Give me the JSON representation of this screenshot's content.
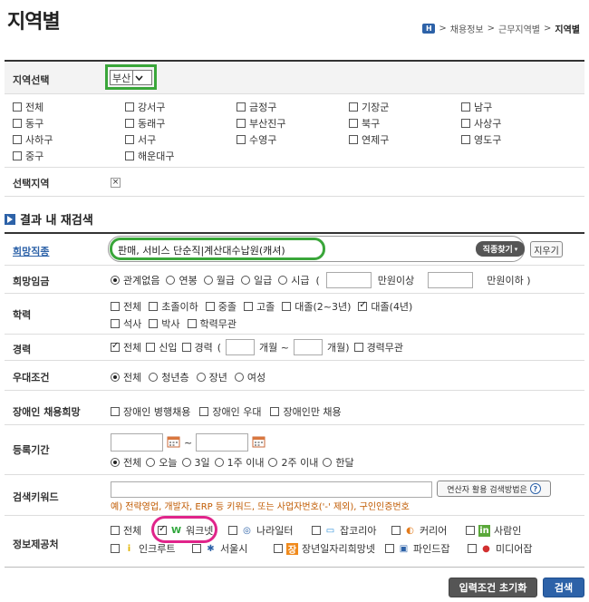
{
  "header": {
    "title": "지역별",
    "breadcrumb": [
      "채용정보",
      "근무지역별",
      "지역별"
    ]
  },
  "region_select": {
    "label": "지역선택",
    "selected": "부산",
    "districts": [
      {
        "label": "전체",
        "checked": false
      },
      {
        "label": "강서구",
        "checked": false
      },
      {
        "label": "금정구",
        "checked": false
      },
      {
        "label": "기장군",
        "checked": false
      },
      {
        "label": "남구",
        "checked": false
      },
      {
        "label": "동구",
        "checked": false
      },
      {
        "label": "동래구",
        "checked": false
      },
      {
        "label": "부산진구",
        "checked": false
      },
      {
        "label": "북구",
        "checked": false
      },
      {
        "label": "사상구",
        "checked": false
      },
      {
        "label": "사하구",
        "checked": false
      },
      {
        "label": "서구",
        "checked": false
      },
      {
        "label": "수영구",
        "checked": false
      },
      {
        "label": "연제구",
        "checked": false
      },
      {
        "label": "영도구",
        "checked": false
      },
      {
        "label": "중구",
        "checked": false
      },
      {
        "label": "해운대구",
        "checked": false
      }
    ]
  },
  "selected_region": {
    "label": "선택지역",
    "remove_symbol": "×"
  },
  "research": {
    "section_title": "결과 내 재검색",
    "job": {
      "label": "희망직종",
      "value": "판매, 서비스 단순직|계산대수납원(캐셔)",
      "find_button": "직종찾기",
      "clear_button": "지우기"
    },
    "wage": {
      "label": "희망임금",
      "options": [
        {
          "label": "관계없음",
          "checked": true
        },
        {
          "label": "연봉",
          "checked": false
        },
        {
          "label": "월급",
          "checked": false
        },
        {
          "label": "일급",
          "checked": false
        },
        {
          "label": "시급",
          "checked": false
        }
      ],
      "paren_open": "(",
      "min_suffix": "만원이상",
      "max_suffix": "만원이하 )"
    },
    "education": {
      "label": "학력",
      "options": [
        {
          "label": "전체",
          "checked": false
        },
        {
          "label": "초졸이하",
          "checked": false
        },
        {
          "label": "중졸",
          "checked": false
        },
        {
          "label": "고졸",
          "checked": false
        },
        {
          "label": "대졸(2~3년)",
          "checked": false
        },
        {
          "label": "대졸(4년)",
          "checked": true
        },
        {
          "label": "석사",
          "checked": false
        },
        {
          "label": "박사",
          "checked": false
        },
        {
          "label": "학력무관",
          "checked": false
        }
      ]
    },
    "career": {
      "label": "경력",
      "all": "전체",
      "new": "신입",
      "experienced": "경력",
      "paren_open": "(",
      "month_over": "개월 ~",
      "month_under": "개월)",
      "unrelated": "경력무관"
    },
    "benefits": {
      "label": "우대조건",
      "options": [
        {
          "label": "전체",
          "checked": true
        },
        {
          "label": "청년층",
          "checked": false
        },
        {
          "label": "장년",
          "checked": false
        },
        {
          "label": "여성",
          "checked": false
        }
      ]
    },
    "disabled": {
      "label": "장애인 채용희망",
      "options": [
        {
          "label": "장애인 병행채용",
          "checked": false
        },
        {
          "label": "장애인 우대",
          "checked": false
        },
        {
          "label": "장애인만 채용",
          "checked": false
        }
      ]
    },
    "period": {
      "label": "등록기간",
      "tilde": "~",
      "options": [
        {
          "label": "전체",
          "checked": true
        },
        {
          "label": "오늘",
          "checked": false
        },
        {
          "label": "3일",
          "checked": false
        },
        {
          "label": "1주 이내",
          "checked": false
        },
        {
          "label": "2주 이내",
          "checked": false
        },
        {
          "label": "한달",
          "checked": false
        }
      ]
    },
    "keyword": {
      "label": "검색키워드",
      "help_button": "연산자 활용 검색방법은",
      "example": "예) 전략영업, 개발자, ERP 등 키워드, 또는 사업자번호('-' 제외), 구인인증번호"
    },
    "sources": {
      "label": "정보제공처",
      "items": [
        {
          "label": "전체",
          "checked": false,
          "icon": "none"
        },
        {
          "label": "워크넷",
          "checked": true,
          "icon": "worknet-icon"
        },
        {
          "label": "나라일터",
          "checked": false,
          "icon": "naraillteo-icon"
        },
        {
          "label": "잡코리아",
          "checked": false,
          "icon": "jobkorea-icon"
        },
        {
          "label": "커리어",
          "checked": false,
          "icon": "career-icon"
        },
        {
          "label": "사람인",
          "checked": false,
          "icon": "saramin-icon"
        },
        {
          "label": "인크루트",
          "checked": false,
          "icon": "incruit-icon"
        },
        {
          "label": "서울시",
          "checked": false,
          "icon": "seoul-icon"
        },
        {
          "label": "장년일자리희망넷",
          "checked": false,
          "icon": "senior-job-icon"
        },
        {
          "label": "파인드잡",
          "checked": false,
          "icon": "findjob-icon"
        },
        {
          "label": "미디어잡",
          "checked": false,
          "icon": "mediajob-icon"
        }
      ]
    }
  },
  "footer": {
    "reset_button": "입력조건 초기화",
    "search_button": "검색"
  },
  "colors": {
    "highlight_green": "#3aa63a",
    "highlight_magenta": "#e0248a",
    "brand_blue": "#2d62a8",
    "example_orange": "#c05a00"
  }
}
